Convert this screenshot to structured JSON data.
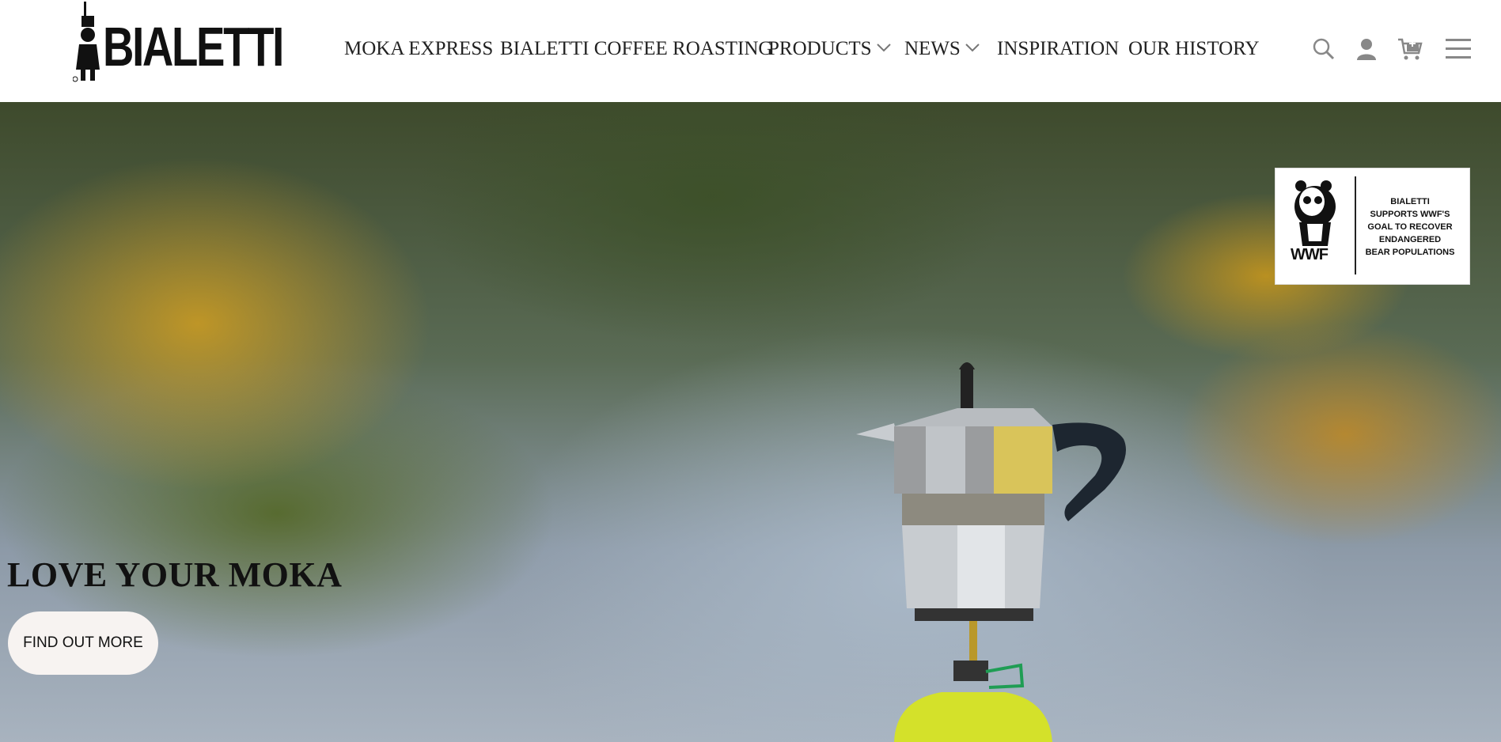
{
  "brand": {
    "logo_text": "BIALETTI"
  },
  "nav": {
    "items": [
      {
        "label": "MOKA EXPRESS",
        "has_dropdown": false
      },
      {
        "label": "BIALETTI COFFEE ROASTING",
        "has_dropdown": false
      },
      {
        "label": "PRODUCTS",
        "has_dropdown": true
      },
      {
        "label": "NEWS",
        "has_dropdown": true
      },
      {
        "label": "INSPIRATION",
        "has_dropdown": false
      },
      {
        "label": "OUR HISTORY",
        "has_dropdown": false
      }
    ]
  },
  "utility": {
    "icons": [
      "search-icon",
      "account-icon",
      "cart-icon",
      "menu-icon"
    ]
  },
  "hero": {
    "title": "LOVE YOUR MOKA",
    "cta_label": "FIND OUT MORE",
    "badge": {
      "logo_text": "WWF",
      "lines": [
        "BIALETTI",
        "SUPPORTS WWF'S",
        "GOAL TO RECOVER",
        "ENDANGERED",
        "BEAR POPULATIONS"
      ]
    }
  },
  "colors": {
    "text": "#222222",
    "cta_bg": "#f7f3f1",
    "header_bg": "#ffffff"
  }
}
